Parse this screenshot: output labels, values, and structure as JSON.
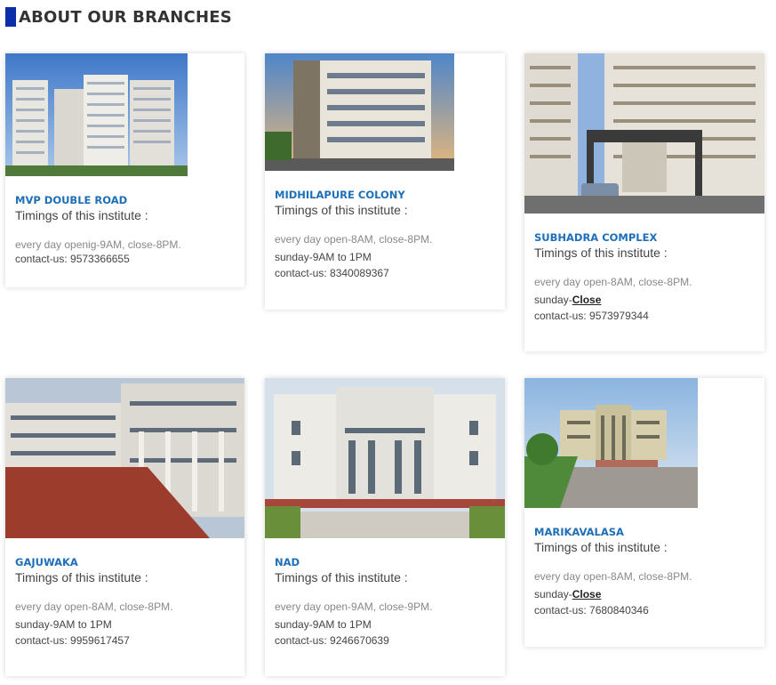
{
  "section": {
    "title": "ABOUT OUR BRANCHES"
  },
  "branches": [
    {
      "name": "MVP DOUBLE ROAD",
      "timings_label": "Timings of this institute :",
      "daily": "every day openig-9AM, close-8PM.",
      "sunday_prefix": "",
      "sunday_value": "",
      "contact": "contact-us: 9573366655"
    },
    {
      "name": "MIDHILAPURE COLONY",
      "timings_label": "Timings of this institute :",
      "daily": "every day open-8AM, close-8PM.",
      "sunday_prefix": "sunday-9AM to 1PM",
      "sunday_value": "",
      "contact": "contact-us: 8340089367"
    },
    {
      "name": "SUBHADRA COMPLEX",
      "timings_label": "Timings of this institute :",
      "daily": "every day open-8AM, close-8PM.",
      "sunday_prefix": "sunday-",
      "sunday_value": "Close",
      "contact": "contact-us: 9573979344"
    },
    {
      "name": "GAJUWAKA",
      "timings_label": "Timings of this institute :",
      "daily": "every day open-8AM, close-8PM.",
      "sunday_prefix": "sunday-9AM to 1PM",
      "sunday_value": "",
      "contact": "contact-us: 9959617457"
    },
    {
      "name": "NAD",
      "timings_label": "Timings of this institute :",
      "daily": "every day open-9AM, close-9PM.",
      "sunday_prefix": "sunday-9AM to 1PM",
      "sunday_value": "",
      "contact": "contact-us: 9246670639"
    },
    {
      "name": "MARIKAVALASA",
      "timings_label": "Timings of this institute :",
      "daily": "every day open-8AM, close-8PM.",
      "sunday_prefix": "sunday-",
      "sunday_value": "Close",
      "contact": "contact-us: 7680840346"
    }
  ],
  "colors": {
    "accent": "#0b2fa8",
    "link": "#1e6fb8"
  }
}
